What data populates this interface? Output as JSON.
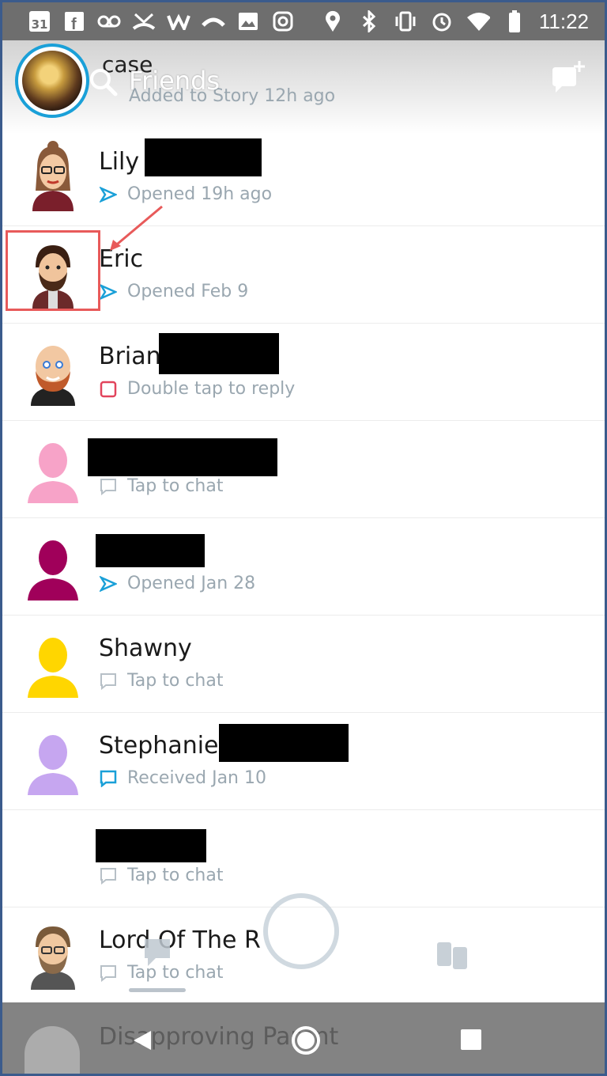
{
  "status_bar": {
    "calendar_day": "31",
    "time": "11:22",
    "left_icons": [
      "facebook-icon",
      "voicemail-icon",
      "missed-call-icon",
      "wattpad-icon",
      "hangup-icon",
      "gallery-icon",
      "instagram-icon"
    ],
    "right_icons": [
      "location-icon",
      "bluetooth-icon",
      "vibrate-icon",
      "alarm-icon",
      "wifi-icon",
      "battery-icon"
    ]
  },
  "header": {
    "title": "Friends",
    "story_name": "case",
    "story_status": "Added to Story 12h ago",
    "accent_color": "#1aa0d8"
  },
  "friends": [
    {
      "name": "Lily",
      "status": "Opened 19h ago",
      "status_icon": "sent-arrow-icon",
      "avatar": "bitmoji-lily"
    },
    {
      "name": "Eric",
      "status": "Opened Feb 9",
      "status_icon": "sent-arrow-icon",
      "avatar": "bitmoji-eric"
    },
    {
      "name": "Brian",
      "status": "Double tap to reply",
      "status_icon": "received-snap-icon",
      "avatar": "bitmoji-brian"
    },
    {
      "name": "",
      "status": "Tap to chat",
      "status_icon": "chat-bubble-icon",
      "avatar": "silhouette-pink"
    },
    {
      "name": "",
      "status": "Opened Jan 28",
      "status_icon": "sent-arrow-icon",
      "avatar": "silhouette-maroon"
    },
    {
      "name": "Shawny",
      "status": "Tap to chat",
      "status_icon": "chat-bubble-icon",
      "avatar": "silhouette-yellow"
    },
    {
      "name": "Stephanie",
      "status": "Received Jan 10",
      "status_icon": "received-chat-icon",
      "avatar": "silhouette-purple"
    },
    {
      "name": "",
      "status": "Tap to chat",
      "status_icon": "chat-bubble-icon",
      "avatar": "none"
    },
    {
      "name": "Lord Of The R",
      "status": "Tap to chat",
      "status_icon": "chat-bubble-icon",
      "avatar": "bitmoji-lord"
    }
  ],
  "ghost_row": {
    "name": "Disapproving Parent"
  },
  "colors": {
    "sent": "#1aa0d8",
    "received_snap": "#e2445c",
    "status_text": "#9aa7b0",
    "pink": "#f7a3c8",
    "maroon": "#a0005a",
    "yellow": "#ffd600",
    "purple": "#c6a6f0",
    "highlight": "#e85a5a"
  }
}
